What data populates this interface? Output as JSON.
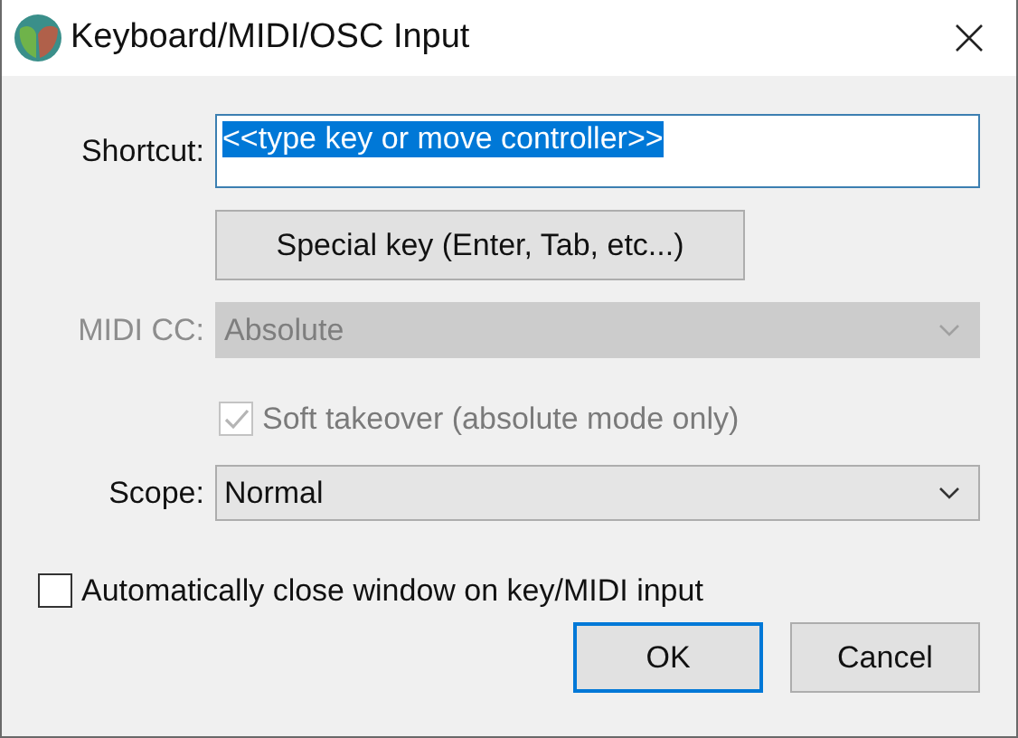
{
  "window": {
    "title": "Keyboard/MIDI/OSC Input"
  },
  "shortcut": {
    "label": "Shortcut:",
    "value": "<<type key or move controller>>",
    "text_selected": true
  },
  "special_key_button": {
    "label": "Special key (Enter, Tab, etc...)"
  },
  "midi_cc": {
    "label": "MIDI CC:",
    "value": "Absolute",
    "disabled": true
  },
  "soft_takeover": {
    "label": "Soft takeover (absolute mode only)",
    "checked": true,
    "disabled": true
  },
  "scope": {
    "label": "Scope:",
    "value": "Normal",
    "disabled": false
  },
  "auto_close": {
    "label": "Automatically close window on key/MIDI input",
    "checked": false
  },
  "buttons": [
    {
      "label": "OK",
      "default": true
    },
    {
      "label": "Cancel",
      "default": false
    }
  ]
}
